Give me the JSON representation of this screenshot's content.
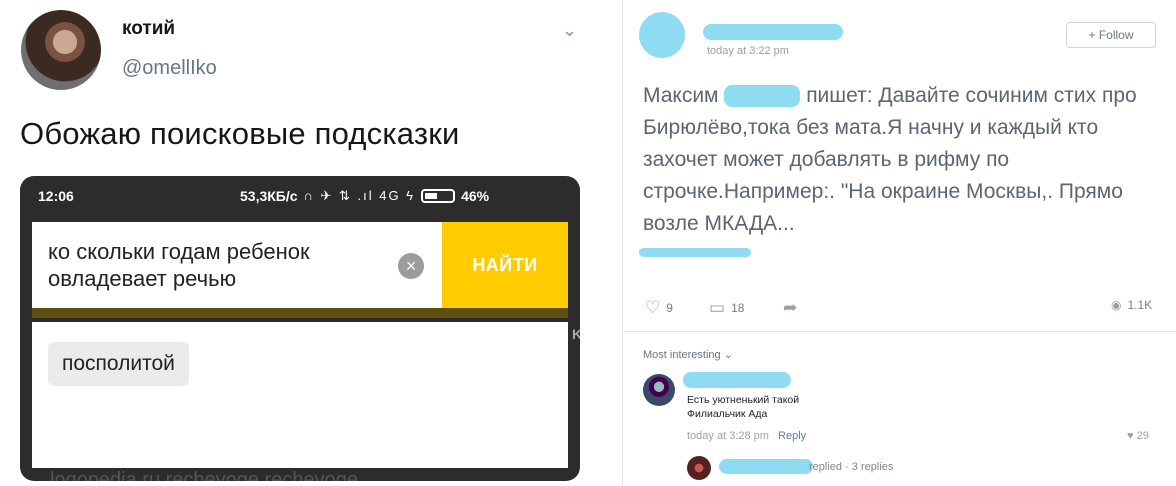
{
  "tweet": {
    "name": "котий",
    "handle": "@omellIko",
    "text": "Обожаю поисковые подсказки",
    "chevron": "⌄"
  },
  "phone": {
    "time": "12:06",
    "speed": "53,3КБ/с",
    "status_icons": "∩ ✈ ⇅ .ıl 4G ϟ",
    "battery": "46%",
    "search_value": "ко скольки годам ребенок овладевает речью",
    "clear_icon": "×",
    "find_label": "НАЙТИ",
    "suggestion": "посполитой",
    "bottom_peek": "logopedia.ru   rechevoge   rechevoge",
    "side_glyph": "K"
  },
  "post": {
    "time": "today at 3:22 pm",
    "follow_label": "+ Follow",
    "text_name": "Максим",
    "text_body": "пишет: Давайте сочиним стих про Бирюлёво,тока без мата.Я начну и каждый кто захочет может добавлять в рифму по строчке.Например:. \"На окраине Москвы,. Прямо возле МКАДА...",
    "likes": "9",
    "comments": "18",
    "views": "1.1K",
    "like_icon": "♡",
    "comment_icon": "▭",
    "share_icon": "➦",
    "view_icon": "◉"
  },
  "comments": {
    "sort_label": "Most interesting ⌄",
    "top": {
      "text_line1": "Есть уютненький такой",
      "text_line2": "Филиальчик Ада",
      "time": "today at 3:28 pm",
      "reply_label": "Reply",
      "likes": "♥ 29"
    },
    "reply_summary": "replied · 3 replies"
  },
  "colors": {
    "find_button": "#ffcc00",
    "redaction": "#8fdcf2"
  }
}
